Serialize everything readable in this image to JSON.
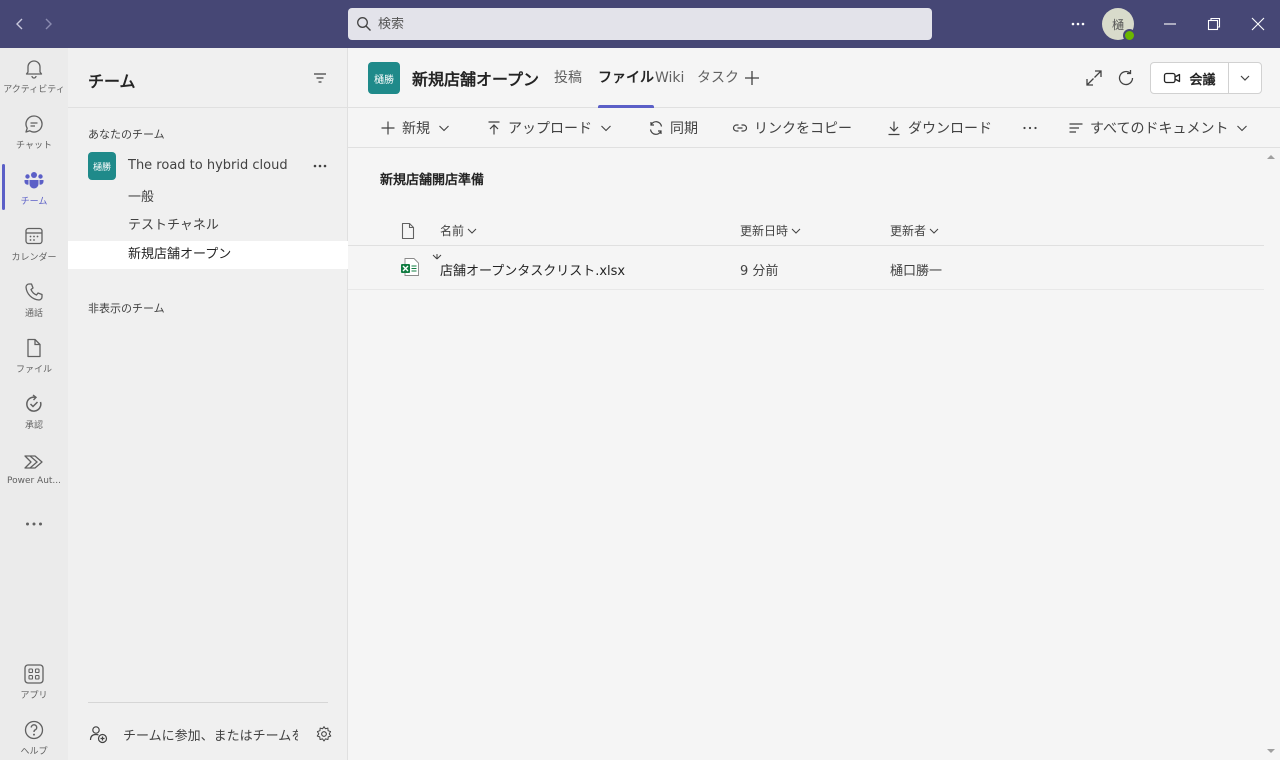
{
  "search": {
    "placeholder": "検索"
  },
  "user": {
    "avatar_initial": "樋"
  },
  "rail": {
    "items": [
      {
        "label": "アクティビティ",
        "icon": "bell-icon"
      },
      {
        "label": "チャット",
        "icon": "chat-icon"
      },
      {
        "label": "チーム",
        "icon": "teams-icon"
      },
      {
        "label": "カレンダー",
        "icon": "calendar-icon"
      },
      {
        "label": "通話",
        "icon": "phone-icon"
      },
      {
        "label": "ファイル",
        "icon": "file-icon"
      },
      {
        "label": "承認",
        "icon": "approvals-icon"
      },
      {
        "label": "Power Aut...",
        "icon": "power-automate-icon"
      }
    ],
    "apps_label": "アプリ",
    "help_label": "ヘルプ"
  },
  "teams_panel": {
    "title": "チーム",
    "your_teams_label": "あなたのチーム",
    "team": {
      "tile": "樋勝",
      "name": "The road to hybrid cloud"
    },
    "channels": [
      "一般",
      "テストチャネル",
      "新規店舗オープン"
    ],
    "hidden_teams_label": "非表示のチーム",
    "join_label": "チームに参加、またはチームを..."
  },
  "channel_header": {
    "tile": "樋勝",
    "title": "新規店舗オープン",
    "tabs": [
      "投稿",
      "ファイル",
      "Wiki",
      "タスク"
    ],
    "active_tab": "ファイル",
    "meet_label": "会議"
  },
  "command_bar": {
    "new": "新規",
    "upload": "アップロード",
    "sync": "同期",
    "copy_link": "リンクをコピー",
    "download": "ダウンロード",
    "view": "すべてのドキュメント"
  },
  "files": {
    "folder_title": "新規店舗開店準備",
    "columns": {
      "name": "名前",
      "modified": "更新日時",
      "modified_by": "更新者"
    },
    "rows": [
      {
        "name": "店舗オープンタスクリスト.xlsx",
        "modified": "9 分前",
        "modified_by": "樋口勝一"
      }
    ]
  },
  "colors": {
    "titlebar": "#464775",
    "accent": "#5b5fc7",
    "team_tile": "#1f8a8a",
    "excel": "#107c41"
  }
}
